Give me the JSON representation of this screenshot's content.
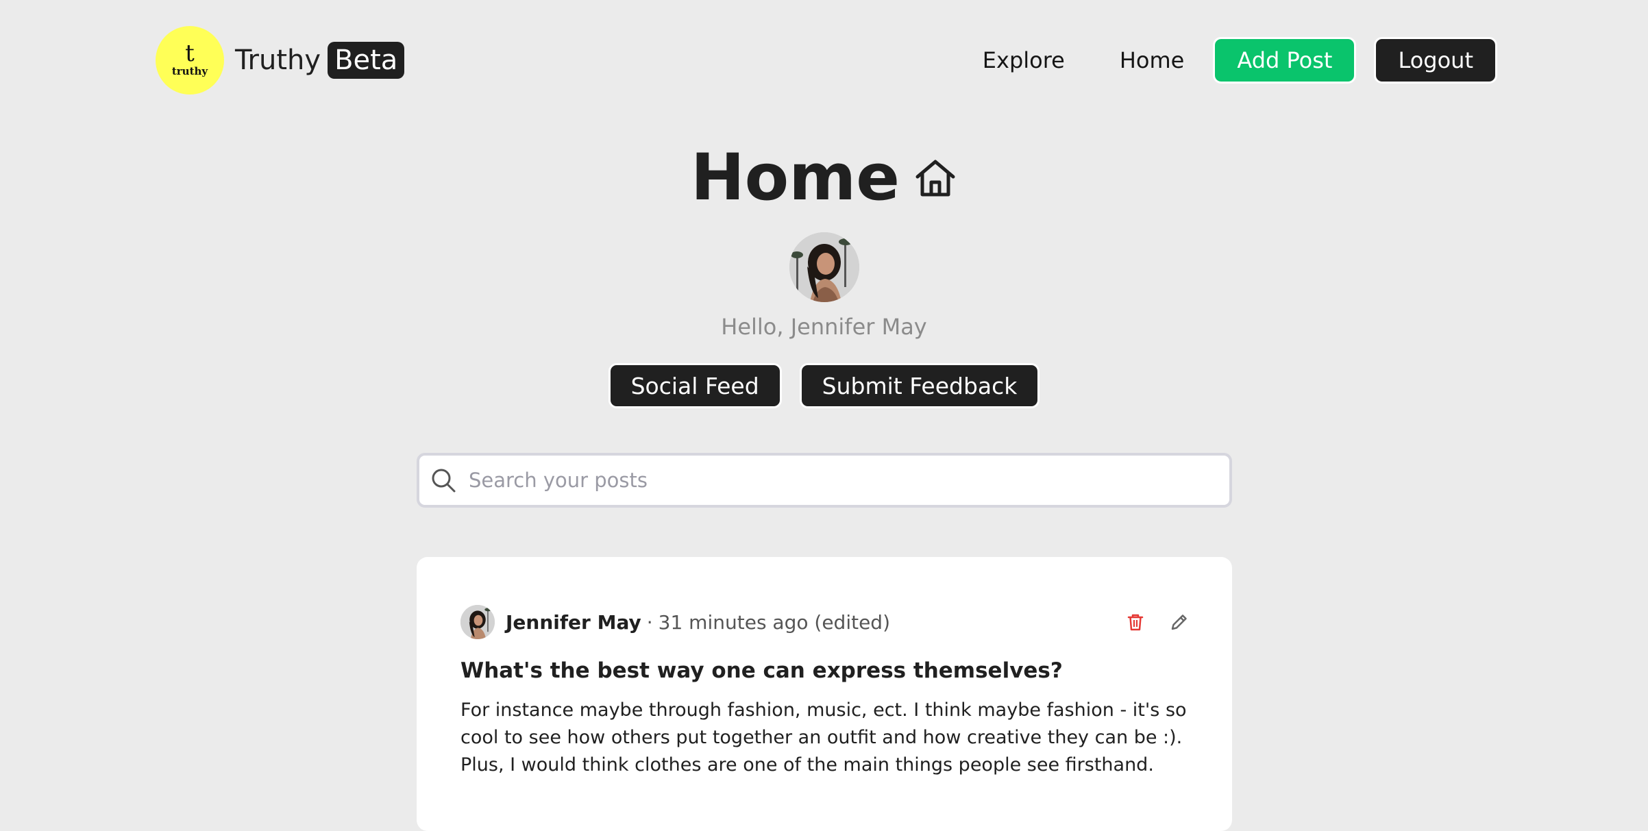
{
  "brand": {
    "logo_letter": "t",
    "logo_word": "truthy",
    "name": "Truthy",
    "badge": "Beta"
  },
  "nav": {
    "explore": "Explore",
    "home": "Home",
    "add_post": "Add Post",
    "logout": "Logout"
  },
  "main": {
    "title": "Home",
    "title_icon": "home-icon",
    "greeting": "Hello, Jennifer May",
    "social_feed": "Social Feed",
    "submit_feedback": "Submit Feedback"
  },
  "search": {
    "placeholder": "Search your posts",
    "value": ""
  },
  "posts": [
    {
      "author": "Jennifer May",
      "separator": "·",
      "time": "31 minutes ago (edited)",
      "title": "What's the best way one can express themselves?",
      "body": "For instance maybe through fashion, music, ect. I think maybe fashion - it's so cool to see how others put together an outfit and how creative they can be :). Plus, I would think clothes are one of the main things people see firsthand.",
      "actions": [
        "trash-icon",
        "pencil-icon"
      ]
    }
  ],
  "colors": {
    "background": "#ebebeb",
    "dark": "#202020",
    "accent_green": "#0ac46c",
    "logo_yellow": "#ffff57",
    "delete_red": "#e53935"
  }
}
